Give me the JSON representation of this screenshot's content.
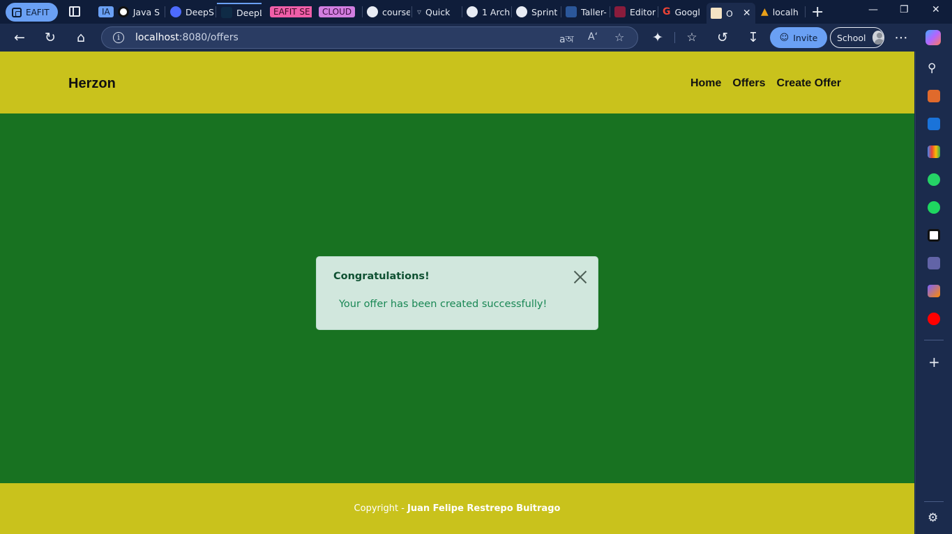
{
  "browser": {
    "profile_label": "EAFIT",
    "tabs": [
      {
        "label": "IA",
        "group_tag": true
      },
      {
        "label": "Java S"
      },
      {
        "label": "DeepS"
      },
      {
        "label": "DeepL"
      },
      {
        "label": "EAFIT SE",
        "group_tag": true
      },
      {
        "label": "CLOUD",
        "group_tag": true
      },
      {
        "label": "course"
      },
      {
        "label": "Quick"
      },
      {
        "label": "1 Arch"
      },
      {
        "label": "Sprint"
      },
      {
        "label": "Taller-"
      },
      {
        "label": "Editor"
      },
      {
        "label": "Googl"
      },
      {
        "label": "O",
        "active": true
      },
      {
        "label": "localh"
      }
    ],
    "url_host": "localhost",
    "url_rest": ":8080/offers",
    "invite_label": "Invite",
    "school_label": "School"
  },
  "site": {
    "brand": "Herzon",
    "nav": [
      "Home",
      "Offers",
      "Create Offer"
    ]
  },
  "alert": {
    "title": "Congratulations!",
    "message": "Your offer has been created successfully!"
  },
  "footer": {
    "prefix": "Copyright - ",
    "author": "Juan Felipe Restrepo Buitrago"
  },
  "colors": {
    "header_bg": "#c9c21c",
    "body_bg": "#187221",
    "alert_bg": "#d1e7dd",
    "alert_title": "#0f5132",
    "alert_text": "#198754"
  },
  "icons": {
    "toolbar": [
      "back-arrow-icon",
      "refresh-icon",
      "home-icon",
      "info-icon",
      "translate-icon",
      "read-aloud-icon",
      "favorite-star-icon",
      "extensions-icon",
      "favorites-icon",
      "history-icon",
      "download-icon",
      "more-icon",
      "copilot-icon"
    ],
    "sidebar": [
      "search-icon",
      "tools-icon",
      "outlook-icon",
      "gmail-icon",
      "whatsapp-icon",
      "spotify-icon",
      "chatgpt-icon",
      "teams-icon",
      "app-icon",
      "youtube-music-icon",
      "add-icon",
      "settings-icon"
    ]
  }
}
